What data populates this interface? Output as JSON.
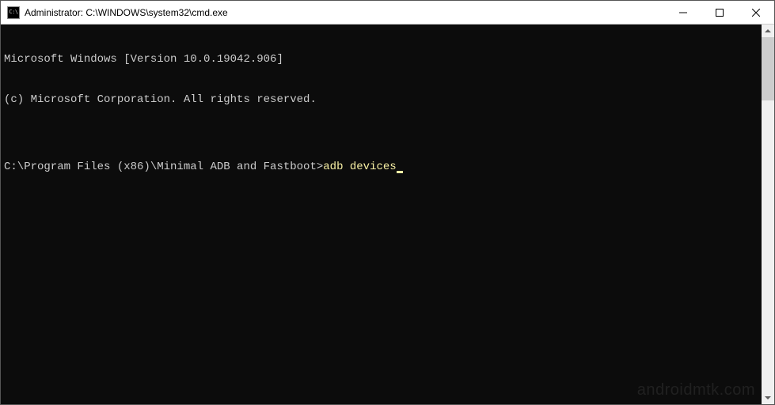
{
  "window": {
    "title": "Administrator: C:\\WINDOWS\\system32\\cmd.exe",
    "icon_label": "C:\\"
  },
  "terminal": {
    "lines": {
      "version": "Microsoft Windows [Version 10.0.19042.906]",
      "copyright": "(c) Microsoft Corporation. All rights reserved.",
      "blank": "",
      "prompt_path": "C:\\Program Files (x86)\\Minimal ADB and Fastboot>",
      "command": "adb devices"
    }
  },
  "watermark": "androidmtk.com"
}
